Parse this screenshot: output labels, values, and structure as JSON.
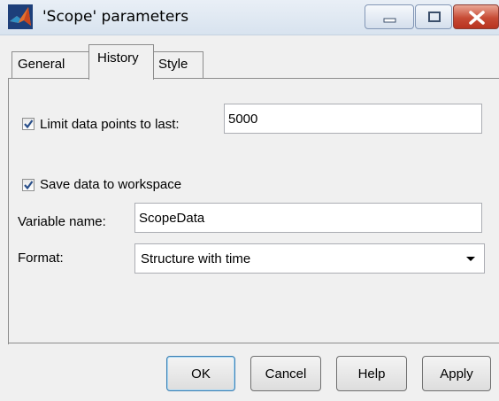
{
  "window": {
    "title": "'Scope' parameters",
    "icon": "matlab-logo-icon",
    "controls": [
      "minimize-icon",
      "maximize-icon",
      "close-icon"
    ]
  },
  "tabs": [
    {
      "label": "General",
      "active": false
    },
    {
      "label": "History",
      "active": true
    },
    {
      "label": "Style",
      "active": false
    }
  ],
  "history": {
    "limit_points": {
      "checked": true,
      "label": "Limit data points to last:",
      "value": "5000"
    },
    "save_workspace": {
      "checked": true,
      "label": "Save data to workspace"
    },
    "variable_name": {
      "label": "Variable name:",
      "value": "ScopeData"
    },
    "format": {
      "label": "Format:",
      "value": "Structure with time"
    }
  },
  "buttons": {
    "ok": "OK",
    "cancel": "Cancel",
    "help": "Help",
    "apply": "Apply"
  },
  "colors": {
    "check_mark": "#2a4f8a",
    "close_button": "#c74b35",
    "default_button_border": "#3c7fb1"
  }
}
